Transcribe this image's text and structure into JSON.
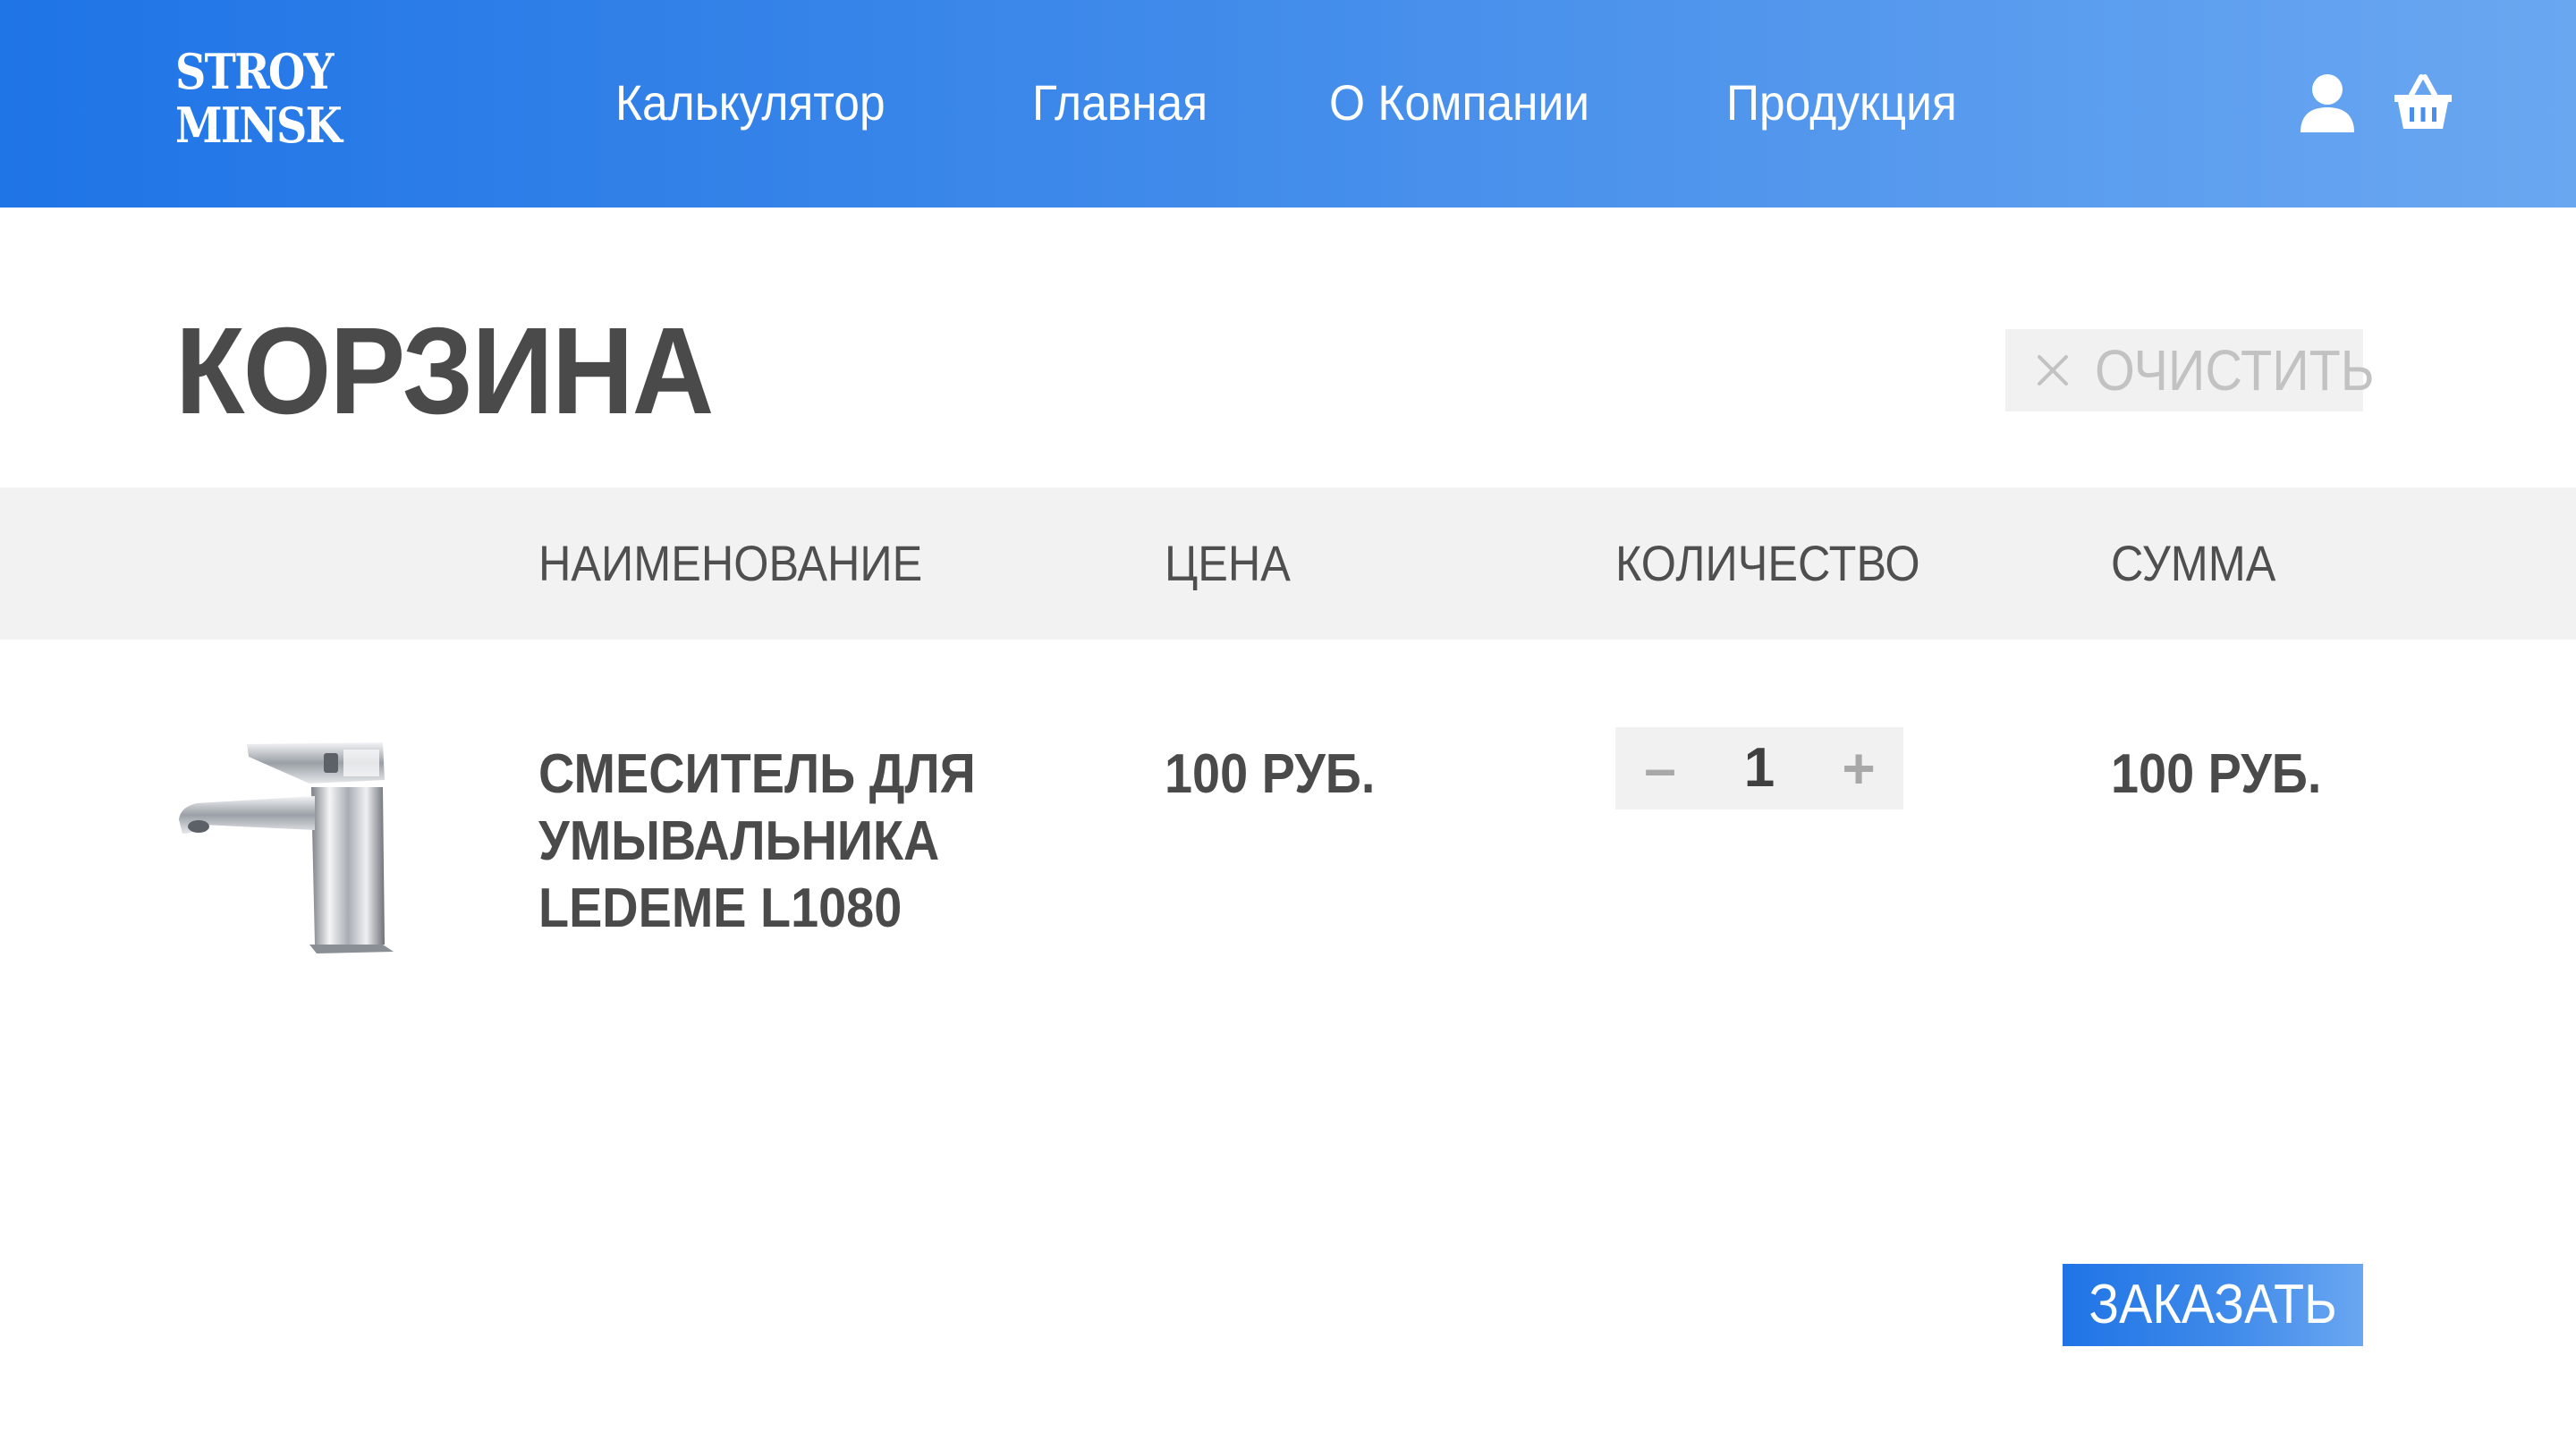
{
  "header": {
    "logo": {
      "line1": "STROY",
      "line2": "MINSK"
    },
    "nav": [
      {
        "label": "Калькулятор"
      },
      {
        "label": "Главная"
      },
      {
        "label": "О Компании"
      },
      {
        "label": "Продукция"
      }
    ],
    "icons": {
      "account": "user-icon",
      "cart": "basket-icon"
    }
  },
  "page": {
    "title": "КОРЗИНА",
    "clear_label": "ОЧИСТИТЬ"
  },
  "table": {
    "columns": [
      "НАИМЕНОВАНИЕ",
      "ЦЕНА",
      "КОЛИЧЕСТВО",
      "СУММА"
    ],
    "rows": [
      {
        "name": "СМЕСИТЕЛЬ ДЛЯ УМЫВАЛЬНИКА LEDEME L1080",
        "price": "100 РУБ.",
        "quantity": "1",
        "minus": "–",
        "plus": "+",
        "sum": "100 РУБ."
      }
    ]
  },
  "order": {
    "label": "ЗАКАЗАТЬ"
  },
  "colors": {
    "brand_start": "#1f74e6",
    "brand_end": "#6aa7f1",
    "text_dark": "#4a4a4a",
    "band_gray": "#f2f2f2"
  }
}
